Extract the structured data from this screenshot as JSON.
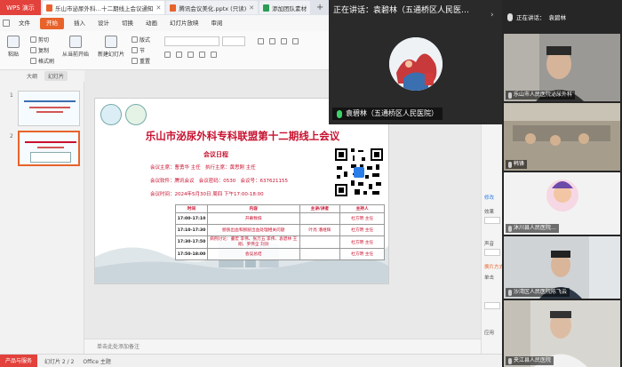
{
  "wps": {
    "logo": "WPS 演示",
    "tabs": [
      {
        "label": "乐山市泌尿外科…十二期线上会议通知"
      },
      {
        "label": "腾讯会议美化.pptx (只读)"
      },
      {
        "label": "添加团队素材"
      }
    ],
    "menu": [
      "文件",
      "开始",
      "插入",
      "设计",
      "切换",
      "动画",
      "幻灯片放映",
      "审阅"
    ],
    "ribbon": {
      "paste": "粘贴",
      "cut": "剪切",
      "copy": "复制",
      "format_painter": "格式刷",
      "from_start": "从当前开始",
      "new_slide": "新建幻灯片",
      "layout": "版式",
      "section": "节",
      "reset": "重置"
    },
    "panel_tabs": {
      "outline": "大纲",
      "slides": "幻灯片"
    },
    "notes_placeholder": "单击此处添加备注",
    "status": {
      "badge": "产品与服务",
      "slide_count": "幻灯片 2 / 2",
      "theme": "Office 主题"
    }
  },
  "slide": {
    "title": "乐山市泌尿外科专科联盟第十二期线上会议",
    "agenda_heading": "会议日程",
    "chair_label": "会议主席：曹勇华 主任",
    "exec_chair_label": "执行主席：黄思刚 主任",
    "software": "会议软件：腾讯会议",
    "password": "会议密码：0530",
    "meeting_no": "会议号：637621155",
    "time": "会议时间：2024年5月30日  周四 下午17:00-18:00",
    "table": {
      "headers": [
        "时间",
        "内容",
        "主讲/讲者",
        "主持人"
      ],
      "rows": [
        [
          "17:00-17:10",
          "开幕致辞",
          "",
          "杜方明 主任"
        ],
        [
          "17:10-17:30",
          "膀胱出血和膀胱出血处理相关问题",
          "叶亮 潘继辉",
          "杜方明 主任"
        ],
        [
          "17:30-17:50",
          "病例讨论：董宏 李伟、张万五 李伟、袁碧林 王刚、罗伟全 刘剑",
          "",
          "杜方明 主任"
        ],
        [
          "17:50-18:00",
          "会议总结",
          "",
          "杜方明 主任"
        ]
      ]
    }
  },
  "meeting": {
    "speaking_label": "正在讲话：袁碧林（五通桥区人民医…",
    "speaker_name": "袁碧林（五通桥区人民医院）",
    "side_header": "正在讲话：",
    "side_header_name": "袁碧林",
    "participants": [
      {
        "name": "乐山市人民医院泌尿外科"
      },
      {
        "name": "韩锋"
      },
      {
        "name": "沐川县人民医院…"
      },
      {
        "name": "沙湾区人民医院陈飞云"
      },
      {
        "name": "夹江县人民医院"
      }
    ]
  },
  "ppt_side": {
    "items": [
      "修改",
      "效果",
      "声音",
      "换片方式",
      "单击",
      "应用"
    ]
  },
  "colors": {
    "wps_red": "#e2413c",
    "accent_orange": "#e8632b",
    "title_red": "#c8102e",
    "mic_green": "#3dd16a"
  }
}
